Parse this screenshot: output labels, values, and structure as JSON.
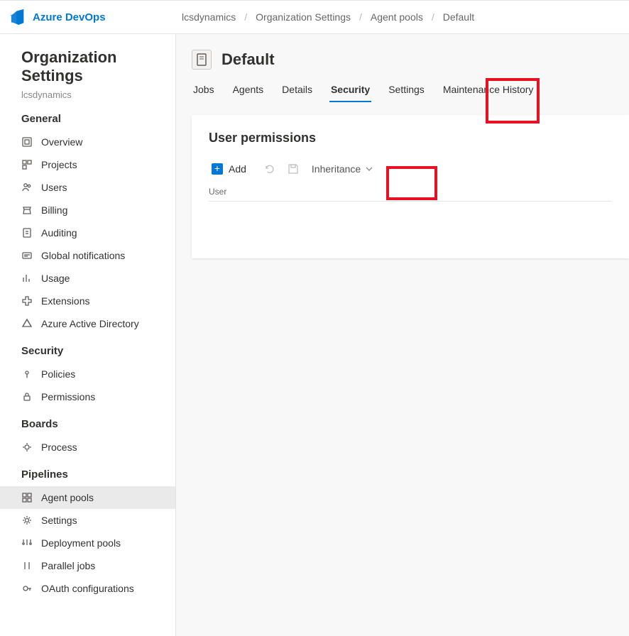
{
  "brand": {
    "name": "Azure DevOps"
  },
  "breadcrumbs": [
    "lcsdynamics",
    "Organization Settings",
    "Agent pools",
    "Default"
  ],
  "sidebar": {
    "title": "Organization Settings",
    "subtitle": "lcsdynamics",
    "sections": [
      {
        "heading": "General",
        "items": [
          {
            "label": "Overview",
            "icon": "overview-icon"
          },
          {
            "label": "Projects",
            "icon": "projects-icon"
          },
          {
            "label": "Users",
            "icon": "users-icon"
          },
          {
            "label": "Billing",
            "icon": "billing-icon"
          },
          {
            "label": "Auditing",
            "icon": "auditing-icon"
          },
          {
            "label": "Global notifications",
            "icon": "notifications-icon"
          },
          {
            "label": "Usage",
            "icon": "usage-icon"
          },
          {
            "label": "Extensions",
            "icon": "extensions-icon"
          },
          {
            "label": "Azure Active Directory",
            "icon": "aad-icon"
          }
        ]
      },
      {
        "heading": "Security",
        "items": [
          {
            "label": "Policies",
            "icon": "policies-icon"
          },
          {
            "label": "Permissions",
            "icon": "permissions-icon"
          }
        ]
      },
      {
        "heading": "Boards",
        "items": [
          {
            "label": "Process",
            "icon": "process-icon"
          }
        ]
      },
      {
        "heading": "Pipelines",
        "items": [
          {
            "label": "Agent pools",
            "icon": "agent-pools-icon",
            "active": true
          },
          {
            "label": "Settings",
            "icon": "settings-icon"
          },
          {
            "label": "Deployment pools",
            "icon": "deployment-pools-icon"
          },
          {
            "label": "Parallel jobs",
            "icon": "parallel-jobs-icon"
          },
          {
            "label": "OAuth configurations",
            "icon": "oauth-icon"
          }
        ]
      }
    ]
  },
  "pool": {
    "name": "Default",
    "tabs": [
      "Jobs",
      "Agents",
      "Details",
      "Security",
      "Settings",
      "Maintenance History"
    ],
    "active_tab": "Security"
  },
  "panel": {
    "heading": "User permissions",
    "add_label": "Add",
    "inheritance_label": "Inheritance",
    "column_header": "User"
  }
}
